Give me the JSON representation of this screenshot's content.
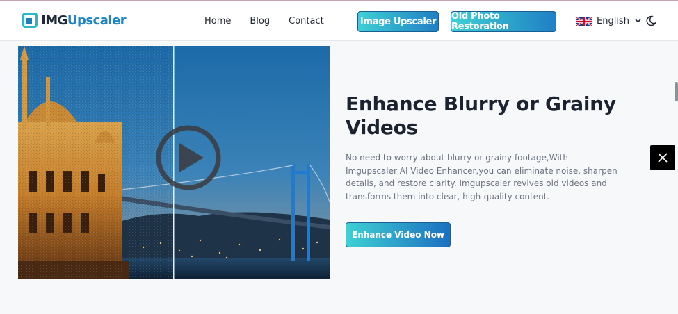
{
  "brand": {
    "name_part1": "IMG",
    "name_part2": "Upscaler"
  },
  "nav": {
    "links": [
      {
        "label": "Home"
      },
      {
        "label": "Blog"
      },
      {
        "label": "Contact"
      }
    ],
    "buttons": {
      "image_upscaler": "Image Upscaler",
      "old_photo_restoration": "Old Photo Restoration"
    },
    "language": "English"
  },
  "hero": {
    "title": "Enhance Blurry or Grainy Videos",
    "description": "No need to worry about blurry or grainy footage,With Imgupscaler AI Video Enhancer,you can eliminate noise, sharpen details, and restore clarity. Imgupscaler revives old videos and transforms them into clear, high-quality content.",
    "cta": "Enhance Video Now"
  },
  "colors": {
    "accent_start": "#3fd0d4",
    "accent_end": "#1f7fc4",
    "brand_blue": "#1f86c3",
    "headline": "#1b2230"
  },
  "icons": {
    "logo": "logo-icon",
    "flag": "uk-flag-icon",
    "chevron": "chevron-down-icon",
    "theme": "moon-icon",
    "play": "play-icon",
    "share": "x-twitter-icon"
  }
}
